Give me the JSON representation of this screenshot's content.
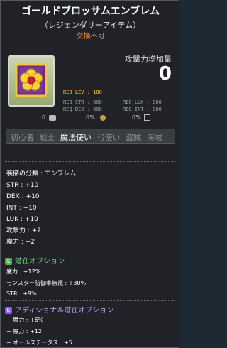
{
  "header": {
    "title": "ゴールドブロッサムエンブレム",
    "rarity": "（レジェンダリーアイテム）",
    "untradable": "交換不可"
  },
  "attack_increase": {
    "label": "攻撃力増加量",
    "value": "0"
  },
  "requirements": {
    "lev": "REQ LEV : 100",
    "str": "REQ STR : 000",
    "luk": "REQ LUK : 000",
    "dex": "REQ DEX : 000",
    "int": "REQ INT : 000"
  },
  "icon_row": {
    "first": "0",
    "second": "0%",
    "third": "0%"
  },
  "jobs": [
    "初心者",
    "戦士",
    "魔法使い",
    "弓使い",
    "盗賊",
    "海賊"
  ],
  "active_job": "魔法使い",
  "item_stats": {
    "type": "装備の分類 : エンブレム",
    "str": "STR : +10",
    "dex": "DEX : +10",
    "int": "INT : +10",
    "luk": "LUK : +10",
    "atk": "攻撃力 : +2",
    "matk": "魔力 : +2"
  },
  "potential": {
    "title": "潜在オプション",
    "lines": [
      "魔力 : +12%",
      "モンスター防御率無視 : +30%",
      "STR : +9%"
    ]
  },
  "additional_potential": {
    "title": "アディショナル潜在オプション",
    "lines": [
      "魔力 : +6%",
      "魔力 : +12",
      "オールステータス : +5"
    ]
  },
  "colors": {
    "title": "#ffffff",
    "untradable": "#ff9a3c",
    "req_lev": "#ffcc33",
    "potential": "#78e07a",
    "additional": "#c8a8ff"
  }
}
